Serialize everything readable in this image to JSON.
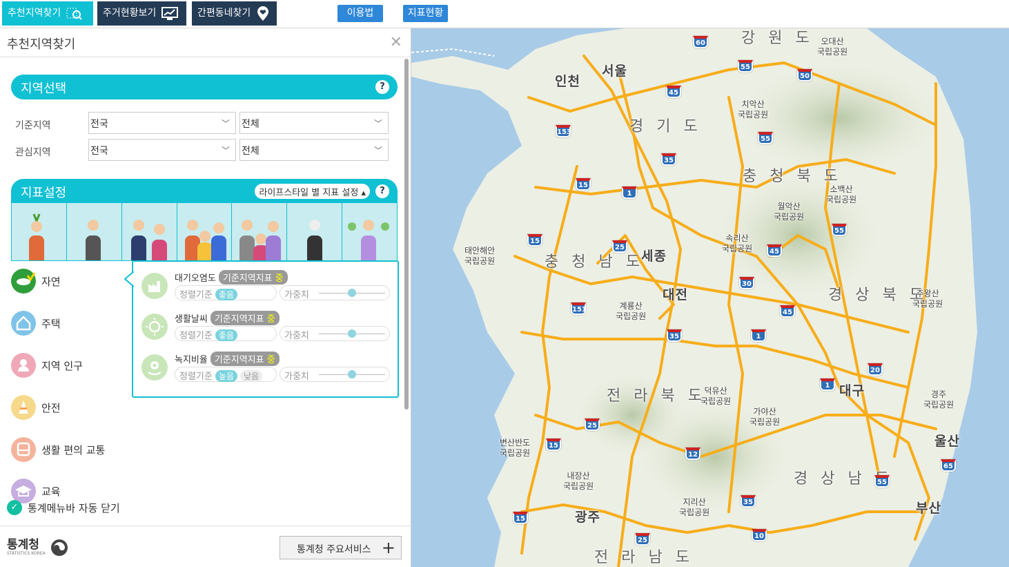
{
  "topbar": {
    "tabs": [
      {
        "label": "추천지역찾기",
        "icon": "map-search-icon"
      },
      {
        "label": "주거현황보기",
        "icon": "monitor-chart-icon"
      },
      {
        "label": "간편동네찾기",
        "icon": "heart-pin-icon"
      }
    ],
    "usage_label": "이용법",
    "indicator_label": "지표현황"
  },
  "panel": {
    "title": "추천지역찾기",
    "region_section": {
      "title": "지역선택",
      "rows": [
        {
          "label": "기준지역",
          "sido": "전국",
          "sigungu": "전체"
        },
        {
          "label": "관심지역",
          "sido": "전국",
          "sigungu": "전체"
        }
      ]
    },
    "indicator_section": {
      "title": "지표설정",
      "lifestyle_label": "라이프스타일 별 지표 설정"
    },
    "categories": [
      {
        "label": "자연",
        "icon": "leaf-fish-icon",
        "color": "#2e9e3a"
      },
      {
        "label": "주택",
        "icon": "house-icon",
        "color": "#7fc3e8"
      },
      {
        "label": "지역 인구",
        "icon": "person-icon",
        "color": "#f0a8b8"
      },
      {
        "label": "안전",
        "icon": "cone-icon",
        "color": "#f6d98a"
      },
      {
        "label": "생활 편의 교통",
        "icon": "bus-icon",
        "color": "#f5b39c"
      },
      {
        "label": "교육",
        "icon": "graduation-cap-icon",
        "color": "#c6aee0"
      }
    ],
    "popup": {
      "rows": [
        {
          "name": "대기오염도",
          "badge": "기준지역지표",
          "level": "중",
          "sort_label": "정렬기준",
          "sort_value": "좋음",
          "sort_alt": "",
          "weight_label": "가중치",
          "weight": 0.5
        },
        {
          "name": "생활날씨",
          "badge": "기준지역지표",
          "level": "중",
          "sort_label": "정렬기준",
          "sort_value": "좋음",
          "sort_alt": "",
          "weight_label": "가중치",
          "weight": 0.5
        },
        {
          "name": "녹지비율",
          "badge": "기준지역지표",
          "level": "중",
          "sort_label": "정렬기준",
          "sort_value": "높음",
          "sort_alt": "낮음",
          "weight_label": "가중치",
          "weight": 0.5
        }
      ]
    },
    "auto_close_label": "통계메뉴바 자동 닫기",
    "footer": {
      "logo_text": "통계청",
      "logo_sub": "STATISTICS KOREA",
      "service_label": "통계청 주요서비스",
      "plus": "+"
    }
  },
  "map": {
    "regions": [
      "강 원 도",
      "경 기 도",
      "충 청 북 도",
      "충 청 남 도",
      "경 상 북 도",
      "전 라 북 도",
      "경 상 남 도",
      "전 라 남 도"
    ],
    "cities": [
      "인천",
      "서울",
      "세종",
      "대전",
      "대구",
      "울산",
      "부산",
      "광주"
    ],
    "parks": [
      "오대산\n국립공원",
      "치악산\n국립공원",
      "소백산\n국립공원",
      "월악산\n국립공원",
      "속리산\n국립공원",
      "태안해안\n국립공원",
      "계룡산\n국립공원",
      "주왕산\n국립공원",
      "덕유산\n국립공원",
      "가야산\n국립공원",
      "경주\n국립공원",
      "변산반도\n국립공원",
      "내장산\n국립공원",
      "지리산\n국립공원"
    ],
    "shields": [
      "60",
      "55",
      "50",
      "45",
      "55",
      "153",
      "35",
      "15",
      "1",
      "15",
      "25",
      "45",
      "30",
      "55",
      "151",
      "35",
      "1",
      "45",
      "20",
      "1",
      "25",
      "15",
      "12",
      "35",
      "55",
      "65",
      "15",
      "25",
      "10"
    ]
  }
}
